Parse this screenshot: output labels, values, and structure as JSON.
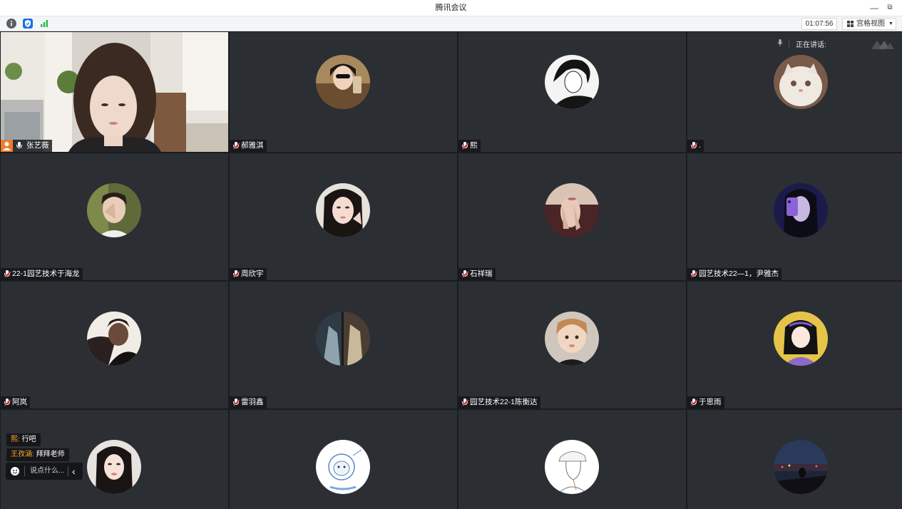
{
  "window": {
    "title": "腾讯会议",
    "minimize": "—",
    "restore": "⧉"
  },
  "toolbar": {
    "timer": "01:07:56",
    "view_label": "宫格视图",
    "view_caret": "▼"
  },
  "speaking": {
    "label": "正在讲话:"
  },
  "tiles": [
    {
      "name": "张艺薇",
      "mic": "on",
      "video": true
    },
    {
      "name": "郝雅淇",
      "mic": "muted"
    },
    {
      "name": "熙",
      "mic": "muted"
    },
    {
      "name": ".",
      "mic": "muted"
    },
    {
      "name": "22-1园艺技术于海龙",
      "mic": "muted"
    },
    {
      "name": "周欣宇",
      "mic": "muted"
    },
    {
      "name": "石祥瑞",
      "mic": "muted"
    },
    {
      "name": "园艺技术22—1，尹雅杰",
      "mic": "muted"
    },
    {
      "name": "阿岚",
      "mic": "muted"
    },
    {
      "name": "雷羽鑫",
      "mic": "muted"
    },
    {
      "name": "园艺技术22-1陈衡达",
      "mic": "muted"
    },
    {
      "name": "于思雨",
      "mic": "muted"
    },
    {
      "name": "",
      "mic": "none"
    },
    {
      "name": "",
      "mic": "none"
    },
    {
      "name": "",
      "mic": "none"
    },
    {
      "name": "",
      "mic": "none"
    }
  ],
  "chat": {
    "messages": [
      {
        "sender": "熙:",
        "text": "行吧"
      },
      {
        "sender": "王孜涵:",
        "text": "拜拜老师"
      }
    ],
    "input_placeholder": "说点什么...",
    "collapse": "‹"
  },
  "colors": {
    "tile_bg": "#2b2e33",
    "accent": "#ffa826",
    "muted_mic": "#e04040",
    "host_badge": "#f07b2d"
  }
}
